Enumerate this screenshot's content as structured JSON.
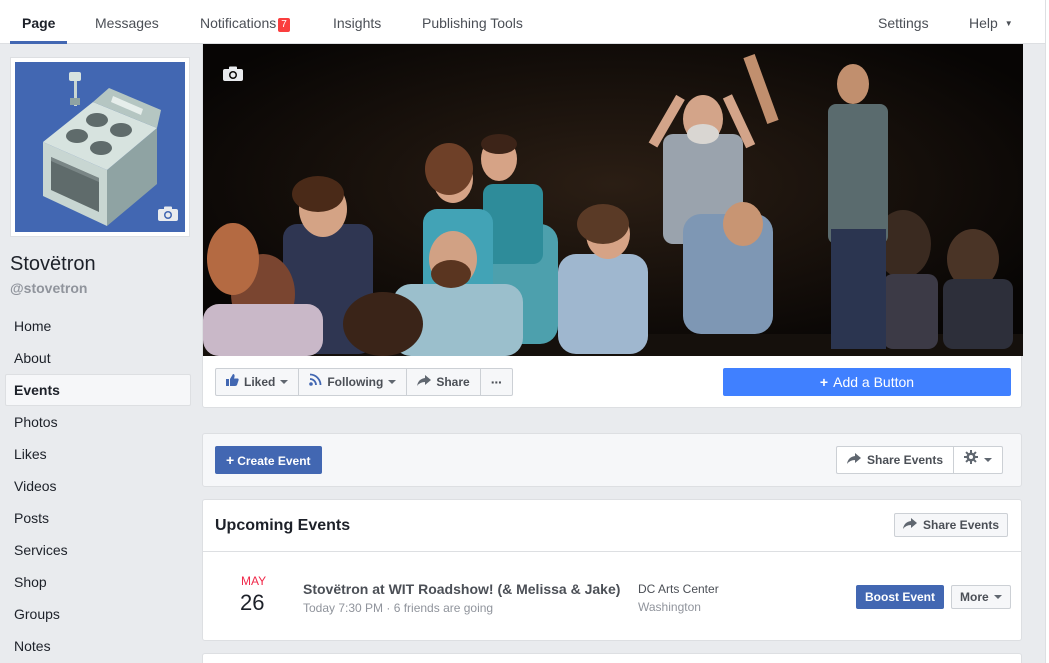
{
  "topnav": {
    "tabs": [
      {
        "label": "Page"
      },
      {
        "label": "Messages"
      },
      {
        "label": "Notifications",
        "badge": "7"
      },
      {
        "label": "Insights"
      },
      {
        "label": "Publishing Tools"
      }
    ],
    "settings_label": "Settings",
    "help_label": "Help"
  },
  "profile": {
    "name": "Stovëtron",
    "handle": "@stovetron",
    "picture_bg_color": "#4267b2"
  },
  "sidebar": {
    "items": [
      {
        "label": "Home"
      },
      {
        "label": "About"
      },
      {
        "label": "Events",
        "active": true
      },
      {
        "label": "Photos"
      },
      {
        "label": "Likes"
      },
      {
        "label": "Videos"
      },
      {
        "label": "Posts"
      },
      {
        "label": "Services"
      },
      {
        "label": "Shop"
      },
      {
        "label": "Groups"
      },
      {
        "label": "Notes"
      }
    ]
  },
  "cover": {
    "actions": {
      "liked": "Liked",
      "following": "Following",
      "share": "Share",
      "more": "···"
    },
    "add_button": "Add a Button"
  },
  "events_bar": {
    "create_event": "Create Event",
    "share_events": "Share Events"
  },
  "upcoming": {
    "title": "Upcoming Events",
    "share_events": "Share Events",
    "events": [
      {
        "month": "MAY",
        "day": "26",
        "title": "Stovëtron at WIT Roadshow! (& Melissa & Jake)",
        "subtitle": "Today 7:30 PM · 6 friends are going",
        "venue": "DC Arts Center",
        "city": "Washington",
        "boost_label": "Boost Event",
        "more_label": "More"
      }
    ]
  },
  "colors": {
    "brand_blue": "#4267b2",
    "add_button_blue": "#4080ff",
    "badge_red": "#fa3e3e",
    "month_red": "#f02849"
  }
}
